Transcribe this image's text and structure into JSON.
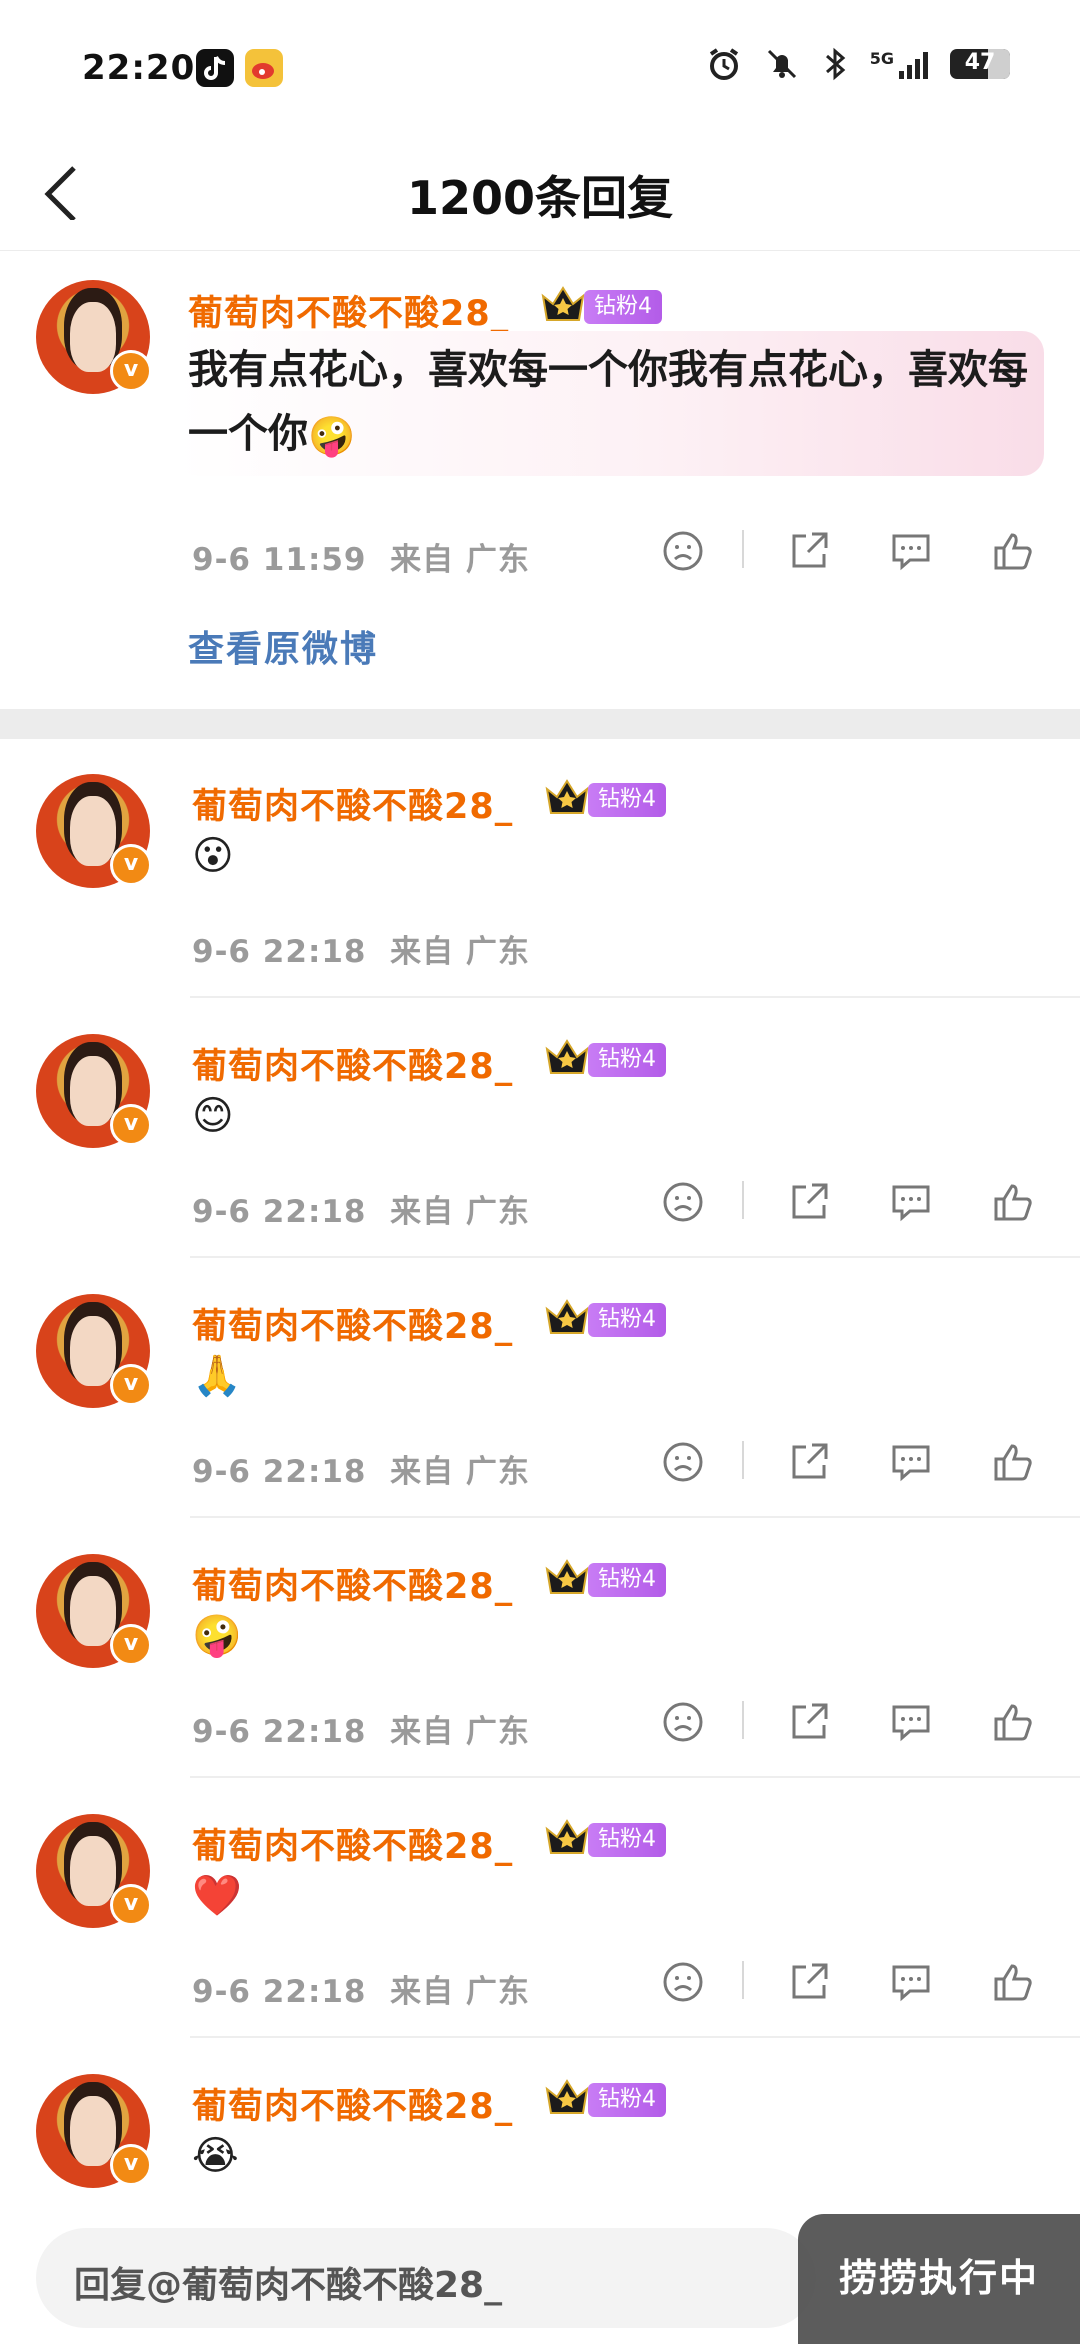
{
  "status_bar": {
    "time": "22:20",
    "apps": [
      "tiktok-icon",
      "weibo-icon"
    ],
    "network": "5G",
    "battery": "47"
  },
  "header": {
    "title": "1200条回复"
  },
  "main_comment": {
    "username": "葡萄肉不酸不酸28_",
    "fan_badge": "钻粉4",
    "text": "我有点花心，喜欢每一个你我有点花心，喜欢每一个你",
    "emoji": "🤪",
    "time": "9-6 11:59",
    "location": "来自 广东",
    "view_original": "查看原微博"
  },
  "replies": [
    {
      "username": "葡萄肉不酸不酸28_",
      "fan_badge": "钻粉4",
      "emoji": "😮",
      "time": "9-6 22:18",
      "location": "来自 广东",
      "show_actions": false
    },
    {
      "username": "葡萄肉不酸不酸28_",
      "fan_badge": "钻粉4",
      "emoji": "😊",
      "time": "9-6 22:18",
      "location": "来自 广东",
      "show_actions": true
    },
    {
      "username": "葡萄肉不酸不酸28_",
      "fan_badge": "钻粉4",
      "emoji": "🙏",
      "time": "9-6 22:18",
      "location": "来自 广东",
      "show_actions": true
    },
    {
      "username": "葡萄肉不酸不酸28_",
      "fan_badge": "钻粉4",
      "emoji": "🤪",
      "time": "9-6 22:18",
      "location": "来自 广东",
      "show_actions": true
    },
    {
      "username": "葡萄肉不酸不酸28_",
      "fan_badge": "钻粉4",
      "emoji": "❤️",
      "time": "9-6 22:18",
      "location": "来自 广东",
      "show_actions": true
    },
    {
      "username": "葡萄肉不酸不酸28_",
      "fan_badge": "钻粉4",
      "emoji": "😭",
      "time": "",
      "location": "",
      "show_actions": false
    }
  ],
  "reply_input": {
    "placeholder": "回复@葡萄肉不酸不酸28_"
  },
  "floating_button": {
    "label": "捞捞执行中"
  },
  "colors": {
    "username": "#f06a00",
    "link": "#4a7ab8",
    "meta": "#9a9a9a",
    "fan_badge": "#b35ce8",
    "verified": "#f28a14"
  }
}
